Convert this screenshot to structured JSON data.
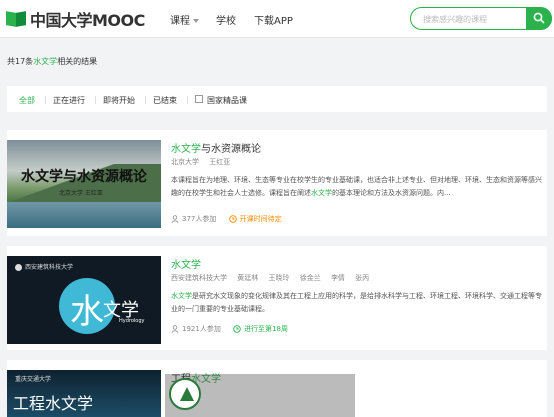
{
  "header": {
    "logo_text": "中国大学MOOC",
    "nav": {
      "course": "课程",
      "school": "学校",
      "app": "下载APP"
    },
    "search": {
      "placeholder": "搜索感兴趣的课程"
    }
  },
  "results": {
    "prefix": "共17条",
    "keyword": "水文学",
    "suffix": "相关的结果"
  },
  "filters": {
    "all": "全部",
    "ongoing": "正在进行",
    "upcoming": "即将开始",
    "ended": "已结束",
    "national_label": "国家精品课"
  },
  "courses": [
    {
      "title_hl": "水文学",
      "title_rest": "与水资源概论",
      "school": "北京大学",
      "teachers": [
        "王红亚"
      ],
      "desc_a": "本课程旨在为地理、环境、生态等专业在校学生的专业基础课，也适合非上述专业、但对地理、环境、生态和资源等感兴趣的在校学生和社会人士选修。课程旨在阐述",
      "desc_hl": "水文学",
      "desc_b": "的基本理论和方法及水资源问题。内...",
      "enrolled": "377人参加",
      "status": "开课时间待定",
      "thumb_title": "水文学与水资源概论",
      "thumb_sub": "北京大学 王红亚"
    },
    {
      "title_hl": "水文学",
      "title_rest": "",
      "school": "西安建筑科技大学",
      "teachers": [
        "黄廷林",
        "王晓玲",
        "徐金兰",
        "李倩",
        "张丙"
      ],
      "desc_hl": "水文学",
      "desc_b": "是研究水文现象的变化规律及其在工程上应用的科学，是给排水科学与工程、环境工程、环境科学、交通工程等专业的一门重要的专业基础课程。",
      "enrolled": "1921人参加",
      "status": "进行至第18周",
      "thumb_uni": "西安建筑科技大学",
      "thumb_glyph": "水",
      "thumb_glyph2": "文学",
      "thumb_eng": "Hydrology"
    },
    {
      "title_a": "工程",
      "title_hl": "水文学",
      "thumb_uni": "重庆交通大学",
      "thumb_title": "工程水文学"
    }
  ]
}
